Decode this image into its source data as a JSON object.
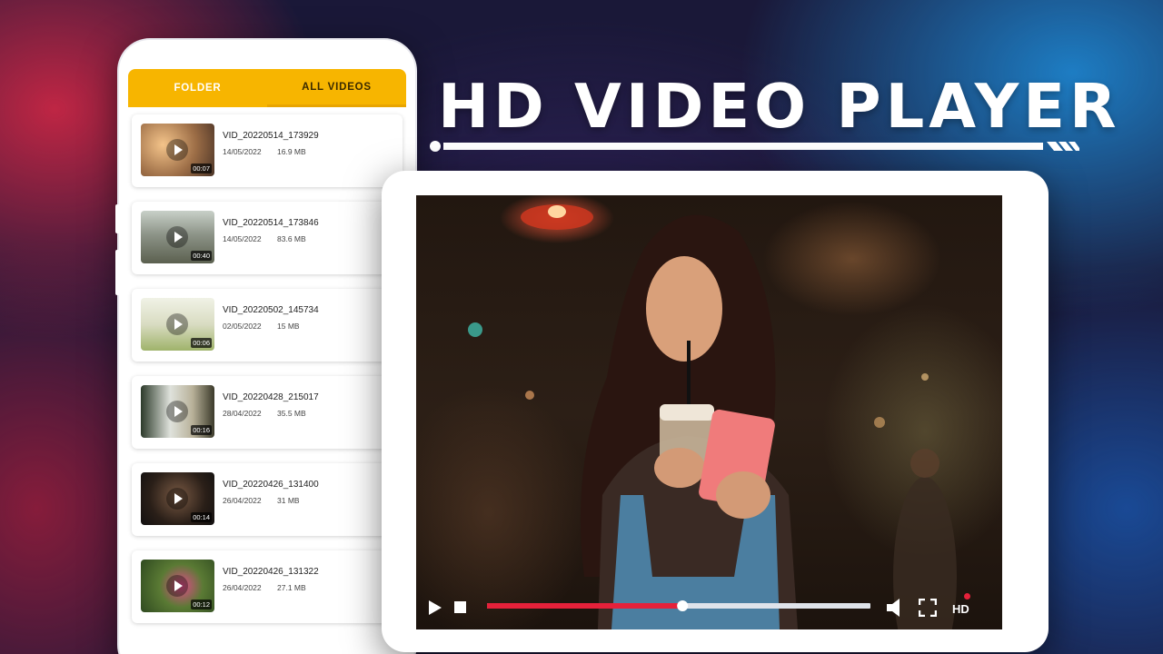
{
  "title": "HD VIDEO PLAYER",
  "tabs": {
    "folder": "FOLDER",
    "all_videos": "ALL VIDEOS",
    "active": "all_videos"
  },
  "accent_color": "#f7b500",
  "videos": [
    {
      "name": "VID_20220514_173929",
      "date": "14/05/2022",
      "size": "16.9 MB",
      "duration": "00:07"
    },
    {
      "name": "VID_20220514_173846",
      "date": "14/05/2022",
      "size": "83.6 MB",
      "duration": "00:40"
    },
    {
      "name": "VID_20220502_145734",
      "date": "02/05/2022",
      "size": "15 MB",
      "duration": "00:06"
    },
    {
      "name": "VID_20220428_215017",
      "date": "28/04/2022",
      "size": "35.5 MB",
      "duration": "00:16"
    },
    {
      "name": "VID_20220426_131400",
      "date": "26/04/2022",
      "size": "31 MB",
      "duration": "00:14"
    },
    {
      "name": "VID_20220426_131322",
      "date": "26/04/2022",
      "size": "27.1 MB",
      "duration": "00:12"
    }
  ],
  "player": {
    "progress": 0.51,
    "progress_color": "#e5213a",
    "quality_label": "HD",
    "icons": [
      "play-icon",
      "stop-icon",
      "volume-icon",
      "fullscreen-icon",
      "hd-icon"
    ]
  }
}
